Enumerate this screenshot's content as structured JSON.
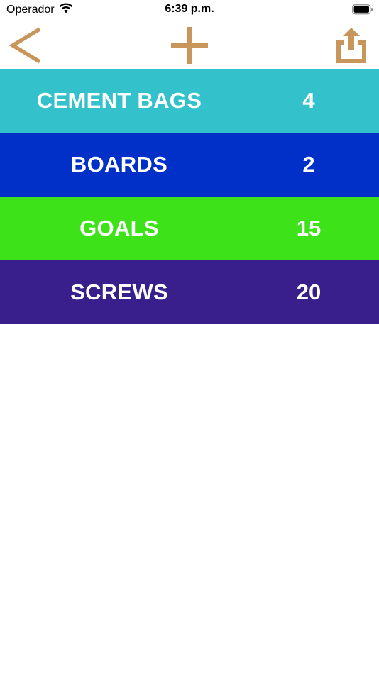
{
  "status_bar": {
    "carrier": "Operador",
    "time": "6:39 p.m.",
    "icons": {
      "wifi": "wifi-icon",
      "battery": "battery-icon"
    }
  },
  "toolbar": {
    "accent_color": "#C8955A",
    "back_icon": "chevron-left-icon",
    "add_icon": "plus-icon",
    "share_icon": "share-icon"
  },
  "items": [
    {
      "name": "CEMENT BAGS",
      "quantity": "4",
      "color": "#33C2CC"
    },
    {
      "name": "BOARDS",
      "quantity": "2",
      "color": "#0030C8"
    },
    {
      "name": "GOALS",
      "quantity": "15",
      "color": "#3DE318"
    },
    {
      "name": "SCREWS",
      "quantity": "20",
      "color": "#391F8C"
    }
  ]
}
